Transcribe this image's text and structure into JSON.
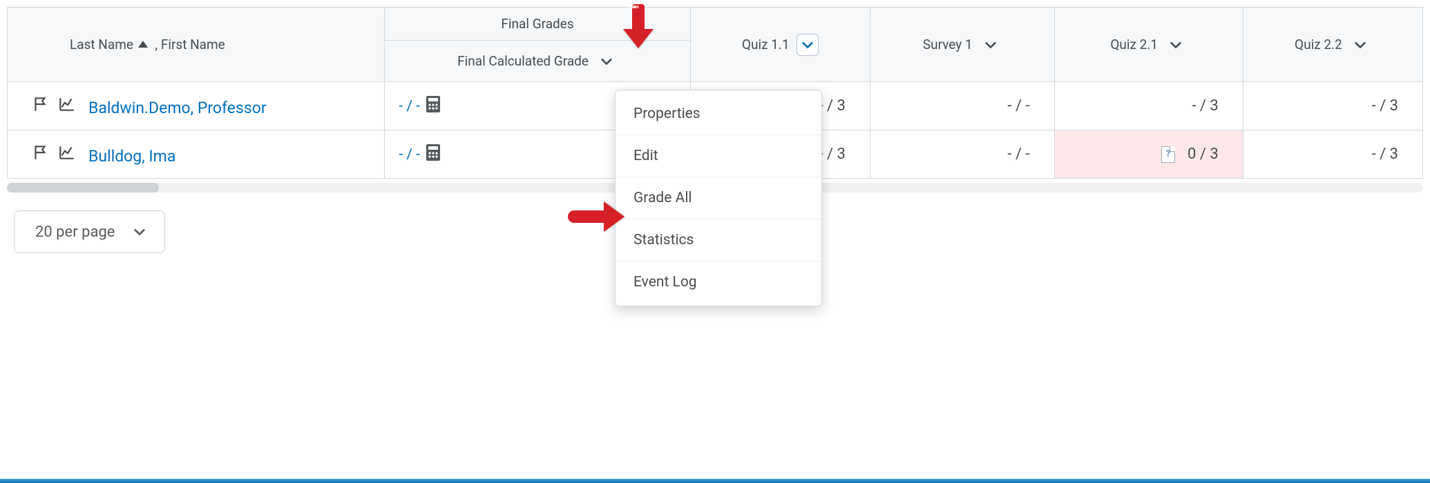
{
  "header": {
    "name_label_prefix": "Last Name",
    "name_label_suffix": ", First Name",
    "final_grades_group": "Final Grades",
    "final_calc_label": "Final Calculated Grade",
    "columns": {
      "quiz11": "Quiz 1.1",
      "survey1": "Survey 1",
      "quiz21": "Quiz 2.1",
      "quiz22": "Quiz 2.2"
    }
  },
  "rows": [
    {
      "name": "Baldwin.Demo, Professor",
      "calc": "- / -",
      "quiz11": "- / 3",
      "survey1": "- / -",
      "quiz21": "- / 3",
      "quiz22": "- / 3",
      "quiz21_pink": false,
      "quiz11_icon": false,
      "quiz21_icon": false
    },
    {
      "name": "Bulldog, Ima",
      "calc": "- / -",
      "quiz11": "- / 3",
      "survey1": "- / -",
      "quiz21": "0 / 3",
      "quiz22": "- / 3",
      "quiz21_pink": true,
      "quiz11_icon": true,
      "quiz21_icon": true
    }
  ],
  "menu": {
    "properties": "Properties",
    "edit": "Edit",
    "grade_all": "Grade All",
    "statistics": "Statistics",
    "event_log": "Event Log"
  },
  "pager": {
    "label": "20 per page"
  },
  "colors": {
    "link": "#006fbf",
    "arrow": "#d62027",
    "pink": "#fde7e8"
  }
}
